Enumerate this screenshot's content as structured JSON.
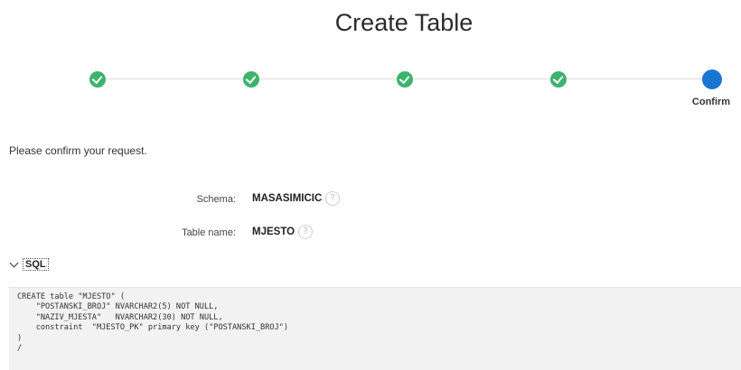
{
  "page": {
    "title": "Create Table"
  },
  "wizard": {
    "steps": [
      {
        "status": "complete",
        "label": ""
      },
      {
        "status": "complete",
        "label": ""
      },
      {
        "status": "complete",
        "label": ""
      },
      {
        "status": "complete",
        "label": ""
      },
      {
        "status": "current",
        "label": "Confirm"
      }
    ],
    "colors": {
      "complete": "#3db36b",
      "current": "#1a74d1"
    }
  },
  "instruction": "Please confirm your request.",
  "fields": {
    "schema": {
      "label": "Schema:",
      "value": "MASASIMICIC",
      "help_icon": "question-mark"
    },
    "table_name": {
      "label": "Table name:",
      "value": "MJESTO",
      "help_icon": "question-mark"
    }
  },
  "sql": {
    "toggle_label": "SQL",
    "toggle_icon": "chevron-down",
    "code": "CREATE table \"MJESTO\" (\n    \"POSTANSKI_BROJ\" NVARCHAR2(5) NOT NULL,\n    \"NAZIV_MJESTA\"   NVARCHAR2(30) NOT NULL,\n    constraint  \"MJESTO_PK\" primary key (\"POSTANSKI_BROJ\")\n)\n/"
  }
}
